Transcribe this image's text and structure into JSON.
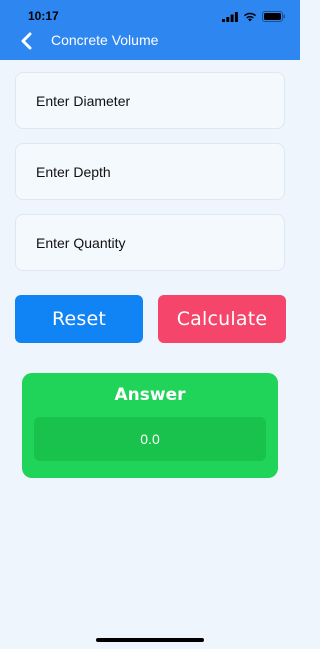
{
  "status_bar": {
    "time": "10:17",
    "icons": [
      "signal-icon",
      "wifi-icon",
      "battery-icon"
    ]
  },
  "nav": {
    "back_icon": "chevron-left-icon",
    "title": "Concrete Volume"
  },
  "form": {
    "diameter_placeholder": "Enter Diameter",
    "depth_placeholder": "Enter Depth",
    "quantity_placeholder": "Enter Quantity"
  },
  "buttons": {
    "reset_label": "Reset",
    "calculate_label": "Calculate"
  },
  "answer": {
    "title": "Answer",
    "value": "0.0"
  },
  "colors": {
    "primary": "#2e86f1",
    "reset": "#1083f5",
    "calculate": "#f5456a",
    "answer_card": "#1fd458",
    "background": "#eef5fc"
  }
}
